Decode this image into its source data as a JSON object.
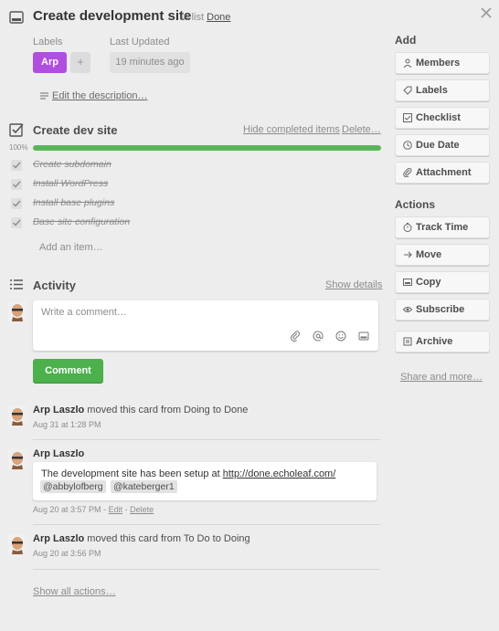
{
  "card": {
    "title": "Create development site",
    "in_list_prefix": "in list",
    "list_name": "Done"
  },
  "meta": {
    "labels_heading": "Labels",
    "label_chip": "Arp",
    "label_chip_color": "#b04ee0",
    "add_label": "+",
    "last_updated_heading": "Last Updated",
    "last_updated_value": "19 minutes ago"
  },
  "description": {
    "link": "Edit the description…"
  },
  "checklist": {
    "title": "Create dev site",
    "hide_completed": "Hide completed items",
    "delete": "Delete…",
    "progress_label": "100%",
    "progress": 1.0,
    "progress_color": "#5ab55a",
    "items": [
      {
        "text": "Create subdomain",
        "done": true
      },
      {
        "text": "Install WordPress",
        "done": true
      },
      {
        "text": "Install base plugins",
        "done": true
      },
      {
        "text": "Base site configuration",
        "done": true
      }
    ],
    "add_item": "Add an item…"
  },
  "activity": {
    "title": "Activity",
    "show_details": "Show details",
    "comment_placeholder": "Write a comment…",
    "comment_icons": [
      "attachment-icon",
      "mention-icon",
      "emoji-icon",
      "card-icon"
    ],
    "comment_button": "Comment",
    "entries": [
      {
        "user": "Arp Laszlo",
        "action": "moved this card from Doing to Done",
        "time": "Aug 31 at 1:28 PM"
      },
      {
        "user": "Arp Laszlo",
        "comment_text": "The development site has been setup at",
        "comment_link": "http://done.echoleaf.com/",
        "mentions": [
          "@abbylofberg",
          "@kateberger1"
        ],
        "time": "Aug 20 at 3:57 PM",
        "sep": "-",
        "edit": "Edit",
        "delete": "Delete"
      },
      {
        "user": "Arp Laszlo",
        "action": "moved this card from To Do to Doing",
        "time": "Aug 20 at 3:56 PM"
      }
    ],
    "show_all": "Show all actions…"
  },
  "sidebar": {
    "add_heading": "Add",
    "add_buttons": [
      {
        "label": "Members",
        "icon": "person-icon"
      },
      {
        "label": "Labels",
        "icon": "tag-icon"
      },
      {
        "label": "Checklist",
        "icon": "checkbox-icon"
      },
      {
        "label": "Due Date",
        "icon": "clock-icon"
      },
      {
        "label": "Attachment",
        "icon": "paperclip-icon"
      }
    ],
    "actions_heading": "Actions",
    "action_buttons": [
      {
        "label": "Track Time",
        "icon": "timer-icon"
      },
      {
        "label": "Move",
        "icon": "arrow-right-icon"
      },
      {
        "label": "Copy",
        "icon": "copy-icon"
      },
      {
        "label": "Subscribe",
        "icon": "eye-icon"
      },
      {
        "label": "Archive",
        "icon": "archive-icon"
      }
    ],
    "share": "Share and more…"
  }
}
